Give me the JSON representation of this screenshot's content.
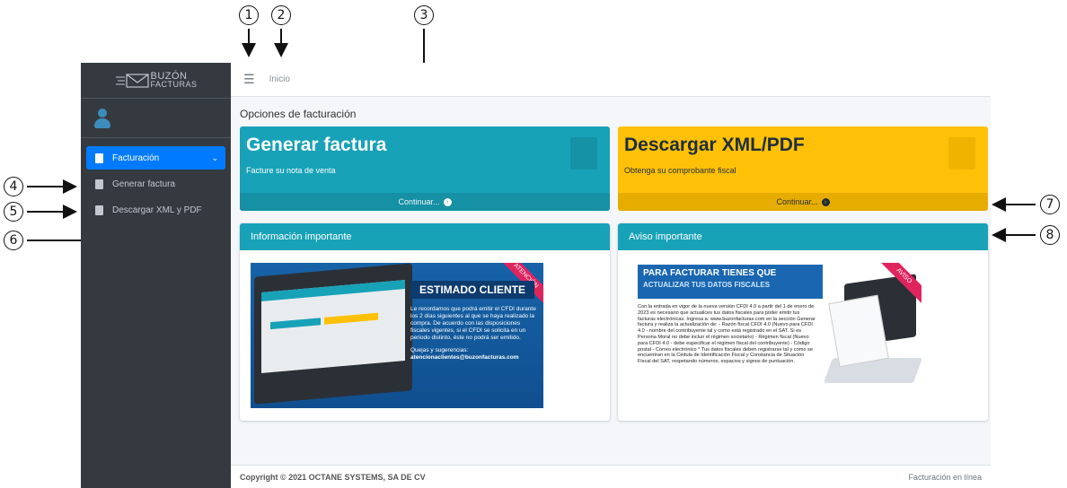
{
  "markers": [
    "1",
    "2",
    "3",
    "4",
    "5",
    "6",
    "7",
    "8"
  ],
  "brand": {
    "line1": "BUZÓN",
    "line2": "FACTURAS"
  },
  "sidebar": {
    "items": [
      {
        "label": "Facturación",
        "icon": "file-icon",
        "active": true
      },
      {
        "label": "Generar factura",
        "icon": "file-icon"
      },
      {
        "label": "Descargar XML y PDF",
        "icon": "file-icon"
      }
    ]
  },
  "topbar": {
    "home_label": "Inicio"
  },
  "main": {
    "section_title": "Opciones de facturación",
    "box_generate": {
      "title": "Generar factura",
      "subtitle": "Facture su nota de venta",
      "link": "Continuar...",
      "color": "#17a2b8"
    },
    "box_download": {
      "title": "Descargar XML/PDF",
      "subtitle": "Obtenga su comprobante fiscal",
      "link": "Continuar...",
      "color": "#ffc107"
    },
    "card_info": {
      "header": "Información importante",
      "banner": {
        "ribbon": "ATENCIÓN",
        "title": "ESTIMADO CLIENTE",
        "text": "Le recordamos que podrá emitir el CFDI durante los 2 días siguientes al que se haya realizado la compra. De acuerdo con las disposiciones fiscales vigentes, si el CFDI se solicita en un periodo distinto, éste no podrá ser emitido.",
        "contact_label": "Quejas y sugerencias:",
        "email": "atencionaclientes@buzonfacturas.com"
      }
    },
    "card_notice": {
      "header": "Aviso importante",
      "banner": {
        "ribbon": "AVISO",
        "title_line1": "PARA FACTURAR TIENES QUE",
        "title_line2": "ACTUALIZAR TUS DATOS FISCALES",
        "text": "Con la entrada en vigor de la nueva versión CFDI 4.0 a partir del 1 de enero de 2023 es necesario que actualices tus datos fiscales para poder emitir tus facturas electrónicas. Ingresa a: www.buzonfacturas.com en la sección Generar factura y realiza la actualización de: - Razón fiscal CFDI 4.0 (Nuevo para CFDI 4.0 - nombre del contribuyente tal y como está registrado en el SAT. Si es Persona Moral no debe incluir el régimen societario) - Régimen fiscal (Nuevo para CFDI 4.0 - debe especificar el régimen fiscal del contribuyente) - Código postal - Correo electrónico * Tus datos fiscales deben registrarse tal y como se encuentran en la Cédula de Identificación Fiscal y Constancia de Situación Fiscal del SAT, respetando números, espacios y signos de puntuación."
      }
    }
  },
  "footer": {
    "copyright": "Copyright © 2021 OCTANE SYSTEMS, SA DE CV",
    "right": "Facturación en línea"
  }
}
